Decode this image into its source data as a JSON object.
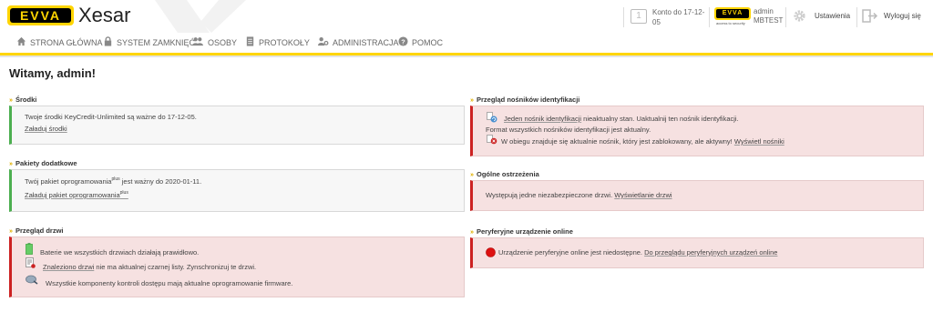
{
  "header": {
    "brand_logo": "EVVA",
    "brand_name": "Xesar",
    "account_label": "Konto do 17-12-05",
    "account_icon_text": "1",
    "mini_logo": "EVVA",
    "mini_logo_sub": "access to security",
    "user_name": "admin",
    "user_tenant": "MBTEST",
    "settings_label": "Ustawienia",
    "logout_label": "Wyloguj się"
  },
  "nav": {
    "items": [
      {
        "label": "STRONA GŁÓWNA",
        "icon": "home-icon"
      },
      {
        "label": "SYSTEM ZAMKNIĘĆ",
        "icon": "lock-icon"
      },
      {
        "label": "OSOBY",
        "icon": "people-icon"
      },
      {
        "label": "PROTOKOŁY",
        "icon": "document-icon"
      },
      {
        "label": "ADMINISTRACJA",
        "icon": "admin-icon"
      },
      {
        "label": "POMOC",
        "icon": "help-icon"
      }
    ]
  },
  "page": {
    "title": "Witamy, admin!"
  },
  "sections": {
    "funds": {
      "title": "Środki",
      "text": "Twoje środki KeyCredit-Unlimited są ważne do 17-12-05.",
      "link": "Załaduj środki"
    },
    "packages": {
      "title": "Pakiety dodatkowe",
      "text_pre": "Twój pakiet oprogramowania",
      "text_sup": "plus",
      "text_post": " jest ważny do 2020-01-11.",
      "link_pre": "Załaduj pakiet oprogramowania",
      "link_sup": "plus"
    },
    "doors": {
      "title": "Przegląd drzwi",
      "battery_text": "Baterie we wszystkich drzwiach działają prawidłowo.",
      "blacklist_link": "Znaleziono drzwi",
      "blacklist_text": " nie ma aktualnej czarnej listy. Zynschronizuj te drzwi.",
      "firmware_text": "Wszystkie komponenty kontroli dostępu mają aktualne oprogramowanie firmware."
    },
    "media": {
      "title": "Przegląd nośników identyfikacji",
      "line1_link": "Jeden nośnik identyfikacji",
      "line1_text": " nieaktualny stan. Uaktualnij ten nośnik identyfikacji.",
      "line2_text": "Format wszystkich nośników identyfikacji jest aktualny.",
      "line3_text": "W obiegu znajduje się aktualnie nośnik, który jest zablokowany, ale aktywny!",
      "line3_link": "Wyświetl nośniki"
    },
    "warnings": {
      "title": "Ogólne ostrzeżenia",
      "text": "Występują jedne niezabezpieczone drzwi.",
      "link": "Wyświetlanie drzwi"
    },
    "peripheral": {
      "title": "Peryferyjne urządzenie online",
      "text": "Urządzenie peryferyjne online jest niedostępne.",
      "link": "Do przeglądu peryferyjnych urządzeń online"
    }
  },
  "colors": {
    "accent": "#ffd500",
    "ok": "#4caf50",
    "error": "#cc2222",
    "error_bg": "#f6e1e1"
  }
}
